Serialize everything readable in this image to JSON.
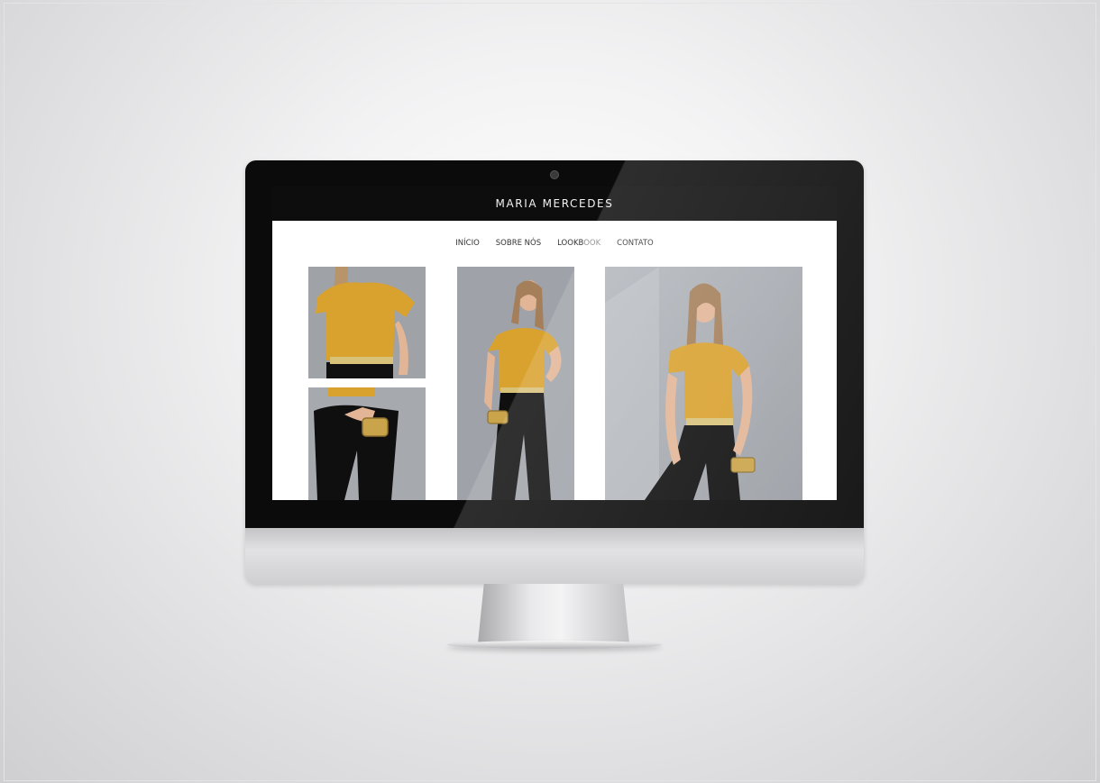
{
  "site": {
    "brand": "MARIA MERCEDES",
    "nav": [
      {
        "label": "INÍCIO"
      },
      {
        "label": "SOBRE NÓS"
      },
      {
        "label_main": "LOOKB",
        "label_rest": "OOK"
      },
      {
        "label": "CONTATO"
      }
    ]
  },
  "colors": {
    "header_bg": "#0d0d0d",
    "accent_top": "#d79a2b",
    "pants": "#0f0f0f"
  },
  "gallery": [
    {
      "name": "lookbook-photo-top-detail"
    },
    {
      "name": "lookbook-photo-pants-detail"
    },
    {
      "name": "lookbook-photo-full-pose"
    },
    {
      "name": "lookbook-photo-large-pose"
    }
  ]
}
